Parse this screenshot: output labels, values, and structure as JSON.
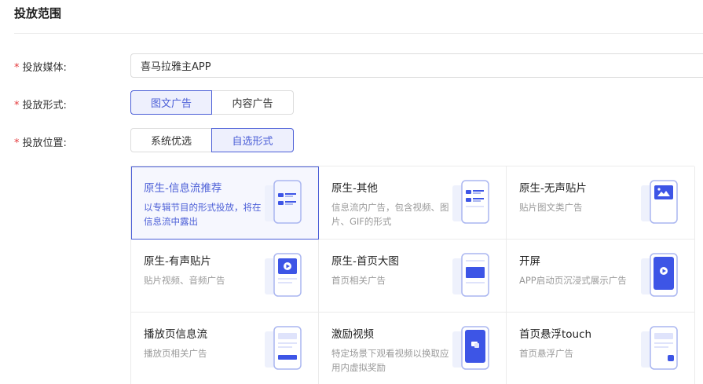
{
  "section": {
    "title": "投放范围"
  },
  "form": {
    "required_mark": "*",
    "media_label": "投放媒体:",
    "media_value": "喜马拉雅主APP",
    "format_label": "投放形式:",
    "format_options": [
      "图文广告",
      "内容广告"
    ],
    "format_selected": 0,
    "position_label": "投放位置:",
    "position_options": [
      "系统优选",
      "自选形式"
    ],
    "position_selected": 1
  },
  "placements": [
    {
      "title": "原生-信息流推荐",
      "desc": "以专辑节目的形式投放，将在信息流中露出",
      "icon": "phone-feed-icon",
      "selected": true
    },
    {
      "title": "原生-其他",
      "desc": "信息流内广告，包含视频、图片、GIF的形式",
      "icon": "phone-feed-icon",
      "selected": false
    },
    {
      "title": "原生-无声贴片",
      "desc": "贴片图文类广告",
      "icon": "phone-image-icon",
      "selected": false
    },
    {
      "title": "原生-有声贴片",
      "desc": "贴片视频、音频广告",
      "icon": "phone-play-icon",
      "selected": false
    },
    {
      "title": "原生-首页大图",
      "desc": "首页相关广告",
      "icon": "phone-banner-icon",
      "selected": false
    },
    {
      "title": "开屏",
      "desc": "APP启动页沉浸式展示广告",
      "icon": "phone-splash-icon",
      "selected": false
    },
    {
      "title": "播放页信息流",
      "desc": "播放页相关广告",
      "icon": "phone-player-feed-icon",
      "selected": false
    },
    {
      "title": "激励视频",
      "desc": "特定场景下观看视频以换取应用内虚拟奖励",
      "icon": "phone-reward-icon",
      "selected": false
    },
    {
      "title": "首页悬浮touch",
      "desc": "首页悬浮广告",
      "icon": "phone-float-icon",
      "selected": false
    }
  ],
  "colors": {
    "accent": "#4c5fd7",
    "required": "#e4393c",
    "icon_blue": "#3d55e6",
    "icon_light": "#dfe3fb"
  }
}
